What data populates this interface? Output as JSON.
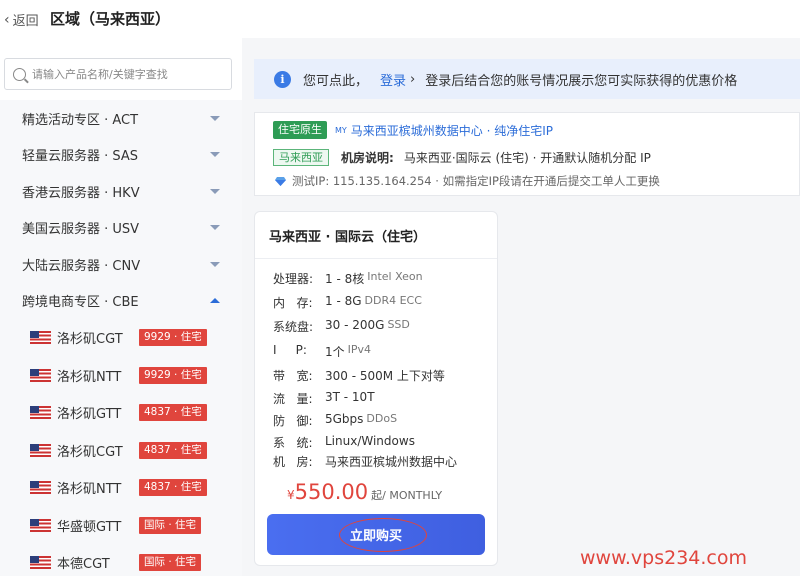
{
  "header": {
    "back_label": "返回",
    "title": "区域（马来西亚）"
  },
  "sidebar": {
    "search_placeholder": "请输入产品名称/关键字查找",
    "menu": [
      {
        "label": "精选活动专区 · ACT",
        "expanded": false
      },
      {
        "label": "轻量云服务器 · SAS",
        "expanded": false
      },
      {
        "label": "香港云服务器 · HKV",
        "expanded": false
      },
      {
        "label": "美国云服务器 · USV",
        "expanded": false
      },
      {
        "label": "大陆云服务器 · CNV",
        "expanded": false
      },
      {
        "label": "跨境电商专区 · CBE",
        "expanded": true
      }
    ],
    "sub_items": [
      {
        "name": "洛杉矶CGT",
        "badge": "9929 · 住宅"
      },
      {
        "name": "洛杉矶NTT",
        "badge": "9929 · 住宅"
      },
      {
        "name": "洛杉矶GTT",
        "badge": "4837 · 住宅"
      },
      {
        "name": "洛杉矶CGT",
        "badge": "4837 · 住宅"
      },
      {
        "name": "洛杉矶NTT",
        "badge": "4837 · 住宅"
      },
      {
        "name": "华盛顿GTT",
        "badge": "国际 · 住宅"
      },
      {
        "name": "本德CGT",
        "badge": "国际 · 住宅"
      }
    ]
  },
  "notice": {
    "prefix": "您可点此，",
    "login_link": "登录",
    "caret": "›",
    "suffix": "登录后结合您的账号情况展示您可实际获得的优惠价格"
  },
  "datacenter": {
    "tag": "住宅原生",
    "my_label": "MY",
    "name": "马来西亚槟城州数据中心 · 纯净住宅IP",
    "region_tag": "马来西亚",
    "desc_label": "机房说明:",
    "desc_value": "马来西亚·国际云 (住宅) · 开通默认随机分配 IP",
    "test_ip_line": "测试IP: 115.135.164.254 · 如需指定IP段请在开通后提交工单人工更换"
  },
  "product": {
    "title": "马来西亚 · 国际云（住宅）",
    "specs": [
      {
        "key": "处理器:",
        "value": "1 - 8核",
        "extra": "Intel Xeon"
      },
      {
        "key": "内   存:",
        "value": "1 - 8G",
        "extra": "DDR4 ECC"
      },
      {
        "key": "系统盘:",
        "value": "30 - 200G",
        "extra": "SSD"
      },
      {
        "key": "I     P:",
        "value": "1个",
        "extra": "IPv4"
      },
      {
        "key": "带   宽:",
        "value": "300 - 500M 上下对等",
        "extra": ""
      },
      {
        "key": "流   量:",
        "value": "3T - 10T",
        "extra": ""
      },
      {
        "key": "防   御:",
        "value": "5Gbps",
        "extra": "DDoS"
      },
      {
        "key": "系   统:",
        "value": "Linux/Windows",
        "extra": ""
      },
      {
        "key": "机   房:",
        "value": "马来西亚槟城州数据中心",
        "extra": ""
      }
    ],
    "currency": "¥",
    "price": "550.00",
    "period": "起/ MONTHLY",
    "buy_label": "立即购买"
  },
  "watermark": "www.vps234.com",
  "colors": {
    "accent": "#2b6cd8",
    "badge_red": "#e0453d",
    "tag_green": "#2e9c55",
    "button": "#4a6ef0"
  }
}
